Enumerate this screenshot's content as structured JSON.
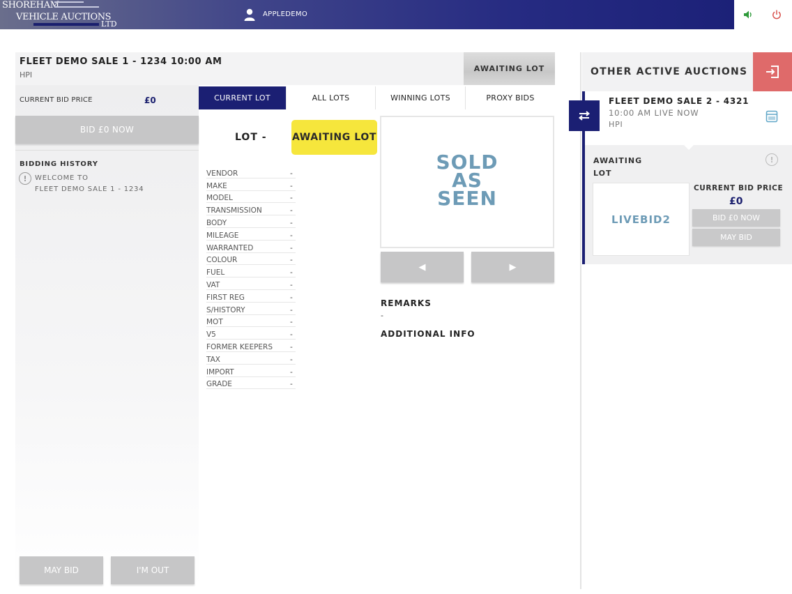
{
  "header": {
    "logo_line1": "SHOREHAM",
    "logo_line2": "VEHICLE AUCTIONS",
    "logo_line3": "LTD",
    "username": "APPLEDEMO",
    "sound_icon": "speaker-icon",
    "power_icon": "power-icon",
    "colors": {
      "brand": "#1b1f73",
      "sound": "#2e9a3a",
      "power": "#d9534f"
    }
  },
  "sale": {
    "title": "FLEET DEMO SALE 1 - 1234 10:00 AM",
    "subtitle": "HPI",
    "status": "AWAITING LOT"
  },
  "left": {
    "current_bid_label": "CURRENT BID PRICE",
    "current_bid_value": "£0",
    "bid_now_label": "BID £0 NOW",
    "history_title": "BIDDING HISTORY",
    "history_msg_line1": "WELCOME TO",
    "history_msg_line2": "FLEET DEMO SALE 1 - 1234",
    "may_bid_label": "MAY BID",
    "im_out_label": "I'M OUT"
  },
  "tabs": [
    {
      "label": "CURRENT LOT",
      "active": true
    },
    {
      "label": "ALL LOTS",
      "active": false
    },
    {
      "label": "WINNING LOTS",
      "active": false
    },
    {
      "label": "PROXY BIDS",
      "active": false
    }
  ],
  "lot": {
    "number_label": "LOT -",
    "status_badge": "AWAITING LOT",
    "specs": [
      {
        "label": "VENDOR",
        "value": "-"
      },
      {
        "label": "MAKE",
        "value": "-"
      },
      {
        "label": "MODEL",
        "value": "-"
      },
      {
        "label": "TRANSMISSION",
        "value": "-"
      },
      {
        "label": "BODY",
        "value": "-"
      },
      {
        "label": "MILEAGE",
        "value": "-"
      },
      {
        "label": "WARRANTED",
        "value": "-"
      },
      {
        "label": "COLOUR",
        "value": "-"
      },
      {
        "label": "FUEL",
        "value": "-"
      },
      {
        "label": "VAT",
        "value": "-"
      },
      {
        "label": "FIRST REG",
        "value": "-"
      },
      {
        "label": "S/HISTORY",
        "value": "-"
      },
      {
        "label": "MOT",
        "value": "-"
      },
      {
        "label": "V5",
        "value": "-"
      },
      {
        "label": "FORMER KEEPERS",
        "value": "-"
      },
      {
        "label": "TAX",
        "value": "-"
      },
      {
        "label": "IMPORT",
        "value": "-"
      },
      {
        "label": "GRADE",
        "value": "-"
      }
    ],
    "image_text_lines": [
      "SOLD",
      "AS",
      "SEEN"
    ],
    "prev_glyph": "◀",
    "next_glyph": "▶",
    "remarks_title": "REMARKS",
    "remarks_value": "-",
    "additional_info_title": "ADDITIONAL INFO"
  },
  "right": {
    "title": "OTHER ACTIVE AUCTIONS",
    "exit_icon": "exit-icon",
    "auction": {
      "title": "FLEET DEMO SALE 2 - 4321",
      "time": "10:00 AM LIVE NOW",
      "subtitle": "HPI",
      "status_line1": "AWAITING",
      "status_line2": "LOT",
      "thumb_text": "LIVEBID2",
      "current_bid_label": "CURRENT BID PRICE",
      "current_bid_value": "£0",
      "bid_now_label": "BID £0 NOW",
      "may_bid_label": "MAY BID"
    }
  }
}
